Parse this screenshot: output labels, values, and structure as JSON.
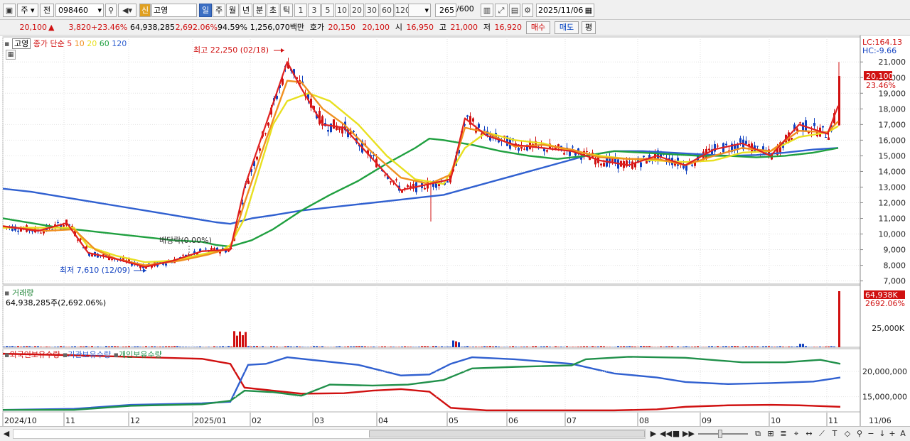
{
  "toolbar": {
    "type_1": "주",
    "type_2": "전",
    "code": "098460",
    "badge": "신",
    "name": "고영",
    "periods": [
      "일",
      "주",
      "월",
      "년",
      "분",
      "초",
      "틱"
    ],
    "active_period": "일",
    "intervals": [
      "1",
      "3",
      "5",
      "10",
      "20",
      "30",
      "60",
      "120"
    ],
    "count_value": "265",
    "count_total": "/600",
    "date": "2025/11/06"
  },
  "info": {
    "price": "20,100",
    "arrow": "▲",
    "change": "3,820",
    "change_pct": "+23.46%",
    "volume": "64,938,285",
    "volume_pct": "2,692.06%",
    "ratio": "94.59%",
    "amount": "1,256,070백만",
    "quote_label": "호가",
    "ask": "20,150",
    "bid": "20,100",
    "open_label": "시",
    "open": "16,950",
    "high_label": "고",
    "high": "21,000",
    "low_label": "저",
    "low": "16,920",
    "buy_button": "매수",
    "sell_button": "매도",
    "eval_button": "평"
  },
  "price_panel": {
    "tag": "고영",
    "legend_label": "종가 단순",
    "ma_periods": [
      "5",
      "10",
      "20",
      "60",
      "120"
    ],
    "ma_colors": [
      "#e02020",
      "#f09020",
      "#e8e020",
      "#20a040",
      "#3060d0"
    ],
    "high_annotation": "최고 22,250 (02/18)",
    "low_annotation": "최저 7,610 (12/09)",
    "dividend_annotation": "배당락(0.00%)",
    "lc_label": "LC:164.13",
    "hc_label": "HC:-9.66",
    "current_price": "20,100",
    "current_pct": "23.46%"
  },
  "volume_panel": {
    "title": "거래량",
    "value_text": "64,938,285주(2,692.06%)",
    "current_value": "64,938K",
    "current_pct": "2692.06%",
    "tick": "25,000K"
  },
  "holding_panel": {
    "legends": [
      "외국인보유수량",
      "기관보유수량",
      "개인보유수량"
    ],
    "colors": [
      "#d01010",
      "#3060d0",
      "#20904a"
    ],
    "ticks": [
      "20,000,000",
      "15,000,000"
    ]
  },
  "x_axis": {
    "labels": [
      "2024/10",
      "11",
      "12",
      "2025/01",
      "02",
      "03",
      "04",
      "05",
      "06",
      "07",
      "08",
      "09",
      "10",
      "11"
    ],
    "right_label": "11/06"
  },
  "chart_data": {
    "type": "candlestick",
    "y_ticks": [
      7000,
      8000,
      9000,
      10000,
      11000,
      12000,
      13000,
      14000,
      15000,
      16000,
      17000,
      18000,
      19000,
      20000,
      21000
    ],
    "y_range": [
      6800,
      22600
    ],
    "ma120": [
      [
        0,
        12900
      ],
      [
        40,
        12700
      ],
      [
        80,
        12400
      ],
      [
        120,
        12100
      ],
      [
        160,
        11800
      ],
      [
        200,
        11500
      ],
      [
        240,
        11200
      ],
      [
        280,
        10900
      ],
      [
        300,
        10750
      ],
      [
        320,
        10650
      ],
      [
        350,
        11000
      ],
      [
        380,
        11200
      ],
      [
        420,
        11500
      ],
      [
        460,
        11700
      ],
      [
        500,
        11900
      ],
      [
        540,
        12100
      ],
      [
        580,
        12300
      ],
      [
        620,
        12500
      ],
      [
        660,
        13000
      ],
      [
        700,
        13500
      ],
      [
        740,
        14000
      ],
      [
        780,
        14500
      ],
      [
        820,
        15000
      ],
      [
        860,
        15300
      ],
      [
        900,
        15300
      ],
      [
        940,
        15200
      ],
      [
        980,
        15100
      ],
      [
        1020,
        15000
      ],
      [
        1060,
        15050
      ],
      [
        1100,
        15200
      ],
      [
        1140,
        15400
      ],
      [
        1175,
        15500
      ]
    ],
    "ma60": [
      [
        0,
        11000
      ],
      [
        40,
        10700
      ],
      [
        80,
        10400
      ],
      [
        120,
        10200
      ],
      [
        160,
        10000
      ],
      [
        200,
        9800
      ],
      [
        240,
        9600
      ],
      [
        280,
        9500
      ],
      [
        300,
        9300
      ],
      [
        320,
        9200
      ],
      [
        350,
        9600
      ],
      [
        380,
        10300
      ],
      [
        420,
        11500
      ],
      [
        460,
        12500
      ],
      [
        500,
        13400
      ],
      [
        540,
        14500
      ],
      [
        580,
        15500
      ],
      [
        600,
        16100
      ],
      [
        620,
        16000
      ],
      [
        660,
        15700
      ],
      [
        700,
        15300
      ],
      [
        740,
        15000
      ],
      [
        780,
        14800
      ],
      [
        820,
        15000
      ],
      [
        860,
        15300
      ],
      [
        900,
        15200
      ],
      [
        940,
        15100
      ],
      [
        980,
        15000
      ],
      [
        1020,
        15000
      ],
      [
        1060,
        14900
      ],
      [
        1100,
        15000
      ],
      [
        1140,
        15200
      ],
      [
        1175,
        15500
      ]
    ],
    "ma20": [
      [
        0,
        10400
      ],
      [
        40,
        10400
      ],
      [
        80,
        10400
      ],
      [
        100,
        10400
      ],
      [
        120,
        9200
      ],
      [
        160,
        8600
      ],
      [
        200,
        8200
      ],
      [
        240,
        8300
      ],
      [
        280,
        8700
      ],
      [
        310,
        9000
      ],
      [
        320,
        9300
      ],
      [
        340,
        11000
      ],
      [
        360,
        14000
      ],
      [
        380,
        17000
      ],
      [
        400,
        18500
      ],
      [
        430,
        19000
      ],
      [
        460,
        18500
      ],
      [
        500,
        17000
      ],
      [
        540,
        15000
      ],
      [
        580,
        13500
      ],
      [
        620,
        13200
      ],
      [
        650,
        15500
      ],
      [
        680,
        16500
      ],
      [
        720,
        16000
      ],
      [
        760,
        15800
      ],
      [
        800,
        15300
      ],
      [
        840,
        15000
      ],
      [
        880,
        14800
      ],
      [
        920,
        14700
      ],
      [
        960,
        14600
      ],
      [
        1000,
        14700
      ],
      [
        1040,
        15200
      ],
      [
        1080,
        15300
      ],
      [
        1120,
        16200
      ],
      [
        1160,
        16500
      ],
      [
        1175,
        16900
      ]
    ],
    "ma10": [
      [
        0,
        10500
      ],
      [
        60,
        10200
      ],
      [
        100,
        10300
      ],
      [
        130,
        9000
      ],
      [
        160,
        8400
      ],
      [
        200,
        8000
      ],
      [
        250,
        8300
      ],
      [
        290,
        8700
      ],
      [
        320,
        9100
      ],
      [
        340,
        12000
      ],
      [
        370,
        16000
      ],
      [
        400,
        19800
      ],
      [
        420,
        19700
      ],
      [
        450,
        18000
      ],
      [
        480,
        17000
      ],
      [
        520,
        15200
      ],
      [
        560,
        13600
      ],
      [
        600,
        13200
      ],
      [
        630,
        13800
      ],
      [
        650,
        16800
      ],
      [
        680,
        16500
      ],
      [
        720,
        15600
      ],
      [
        760,
        15700
      ],
      [
        800,
        15400
      ],
      [
        840,
        14900
      ],
      [
        880,
        14800
      ],
      [
        920,
        14800
      ],
      [
        960,
        14400
      ],
      [
        1000,
        15000
      ],
      [
        1040,
        15500
      ],
      [
        1080,
        15300
      ],
      [
        1120,
        16600
      ],
      [
        1160,
        16500
      ],
      [
        1175,
        17200
      ]
    ],
    "ma5": [
      [
        0,
        10500
      ],
      [
        50,
        10200
      ],
      [
        90,
        10700
      ],
      [
        120,
        8800
      ],
      [
        160,
        8400
      ],
      [
        200,
        7900
      ],
      [
        240,
        8300
      ],
      [
        280,
        8900
      ],
      [
        320,
        9000
      ],
      [
        340,
        13000
      ],
      [
        370,
        17000
      ],
      [
        400,
        21000
      ],
      [
        420,
        19300
      ],
      [
        450,
        17000
      ],
      [
        480,
        16800
      ],
      [
        520,
        14800
      ],
      [
        560,
        12800
      ],
      [
        600,
        13200
      ],
      [
        630,
        13500
      ],
      [
        650,
        17400
      ],
      [
        680,
        16300
      ],
      [
        720,
        15700
      ],
      [
        760,
        15500
      ],
      [
        800,
        15300
      ],
      [
        840,
        14700
      ],
      [
        880,
        14400
      ],
      [
        920,
        15000
      ],
      [
        960,
        14400
      ],
      [
        1000,
        15400
      ],
      [
        1040,
        15800
      ],
      [
        1080,
        15000
      ],
      [
        1120,
        17000
      ],
      [
        1160,
        16400
      ],
      [
        1175,
        18200
      ]
    ],
    "volume_max": 64938,
    "holdings_range": [
      12000000,
      24500000
    ],
    "foreign": [
      [
        0,
        23500000
      ],
      [
        100,
        23200000
      ],
      [
        200,
        22800000
      ],
      [
        280,
        22500000
      ],
      [
        320,
        21500000
      ],
      [
        340,
        16800000
      ],
      [
        380,
        16200000
      ],
      [
        420,
        15600000
      ],
      [
        480,
        15700000
      ],
      [
        520,
        16200000
      ],
      [
        560,
        16500000
      ],
      [
        600,
        16000000
      ],
      [
        630,
        12800000
      ],
      [
        680,
        12300000
      ],
      [
        740,
        12300000
      ],
      [
        800,
        12300000
      ],
      [
        860,
        12300000
      ],
      [
        920,
        12500000
      ],
      [
        960,
        13000000
      ],
      [
        1020,
        13300000
      ],
      [
        1080,
        13400000
      ],
      [
        1120,
        13300000
      ],
      [
        1178,
        13000000
      ]
    ],
    "institution": [
      [
        0,
        12400000
      ],
      [
        100,
        12600000
      ],
      [
        180,
        13400000
      ],
      [
        280,
        13700000
      ],
      [
        320,
        14000000
      ],
      [
        345,
        21300000
      ],
      [
        370,
        21500000
      ],
      [
        400,
        22800000
      ],
      [
        440,
        22200000
      ],
      [
        500,
        21300000
      ],
      [
        560,
        19200000
      ],
      [
        600,
        19400000
      ],
      [
        630,
        21500000
      ],
      [
        660,
        22800000
      ],
      [
        720,
        22400000
      ],
      [
        800,
        21500000
      ],
      [
        860,
        19600000
      ],
      [
        920,
        18800000
      ],
      [
        960,
        17900000
      ],
      [
        1020,
        17500000
      ],
      [
        1080,
        17700000
      ],
      [
        1140,
        18000000
      ],
      [
        1178,
        18800000
      ]
    ],
    "individual": [
      [
        0,
        12400000
      ],
      [
        100,
        12400000
      ],
      [
        180,
        13200000
      ],
      [
        280,
        13500000
      ],
      [
        320,
        14200000
      ],
      [
        340,
        16200000
      ],
      [
        380,
        15900000
      ],
      [
        420,
        15200000
      ],
      [
        460,
        17400000
      ],
      [
        520,
        17200000
      ],
      [
        570,
        17400000
      ],
      [
        620,
        18300000
      ],
      [
        660,
        20600000
      ],
      [
        720,
        20900000
      ],
      [
        800,
        21200000
      ],
      [
        820,
        22400000
      ],
      [
        880,
        22900000
      ],
      [
        960,
        22700000
      ],
      [
        1040,
        21800000
      ],
      [
        1100,
        21800000
      ],
      [
        1150,
        22300000
      ],
      [
        1178,
        21500000
      ]
    ]
  }
}
